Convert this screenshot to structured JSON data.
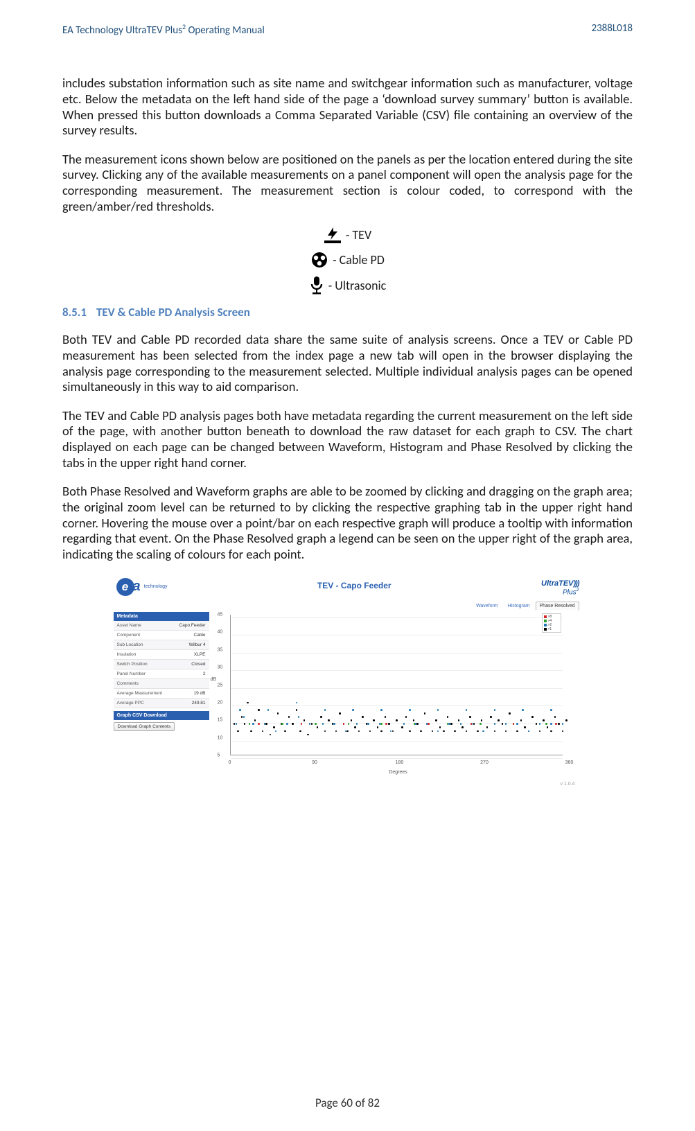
{
  "header": {
    "left_prefix": "EA Technology UltraTEV Plus",
    "left_super": "2",
    "left_suffix": " Operating Manual",
    "right": "2388L018"
  },
  "para1": "includes substation information such as site name and switchgear information such as manufacturer, voltage etc. Below the metadata on the left hand side of the page a ‘download survey summary’ button is available. When pressed this button downloads a Comma Separated Variable (CSV) file containing an overview of the survey results.",
  "para2": "The measurement icons shown below are positioned on the panels as per the location entered during the site survey. Clicking any of the available measurements on a panel component will open the analysis page for the corresponding measurement.   The measurement section is colour coded, to correspond with the green/amber/red thresholds.",
  "icons": {
    "tev": "- TEV",
    "cable": "- Cable PD",
    "ultra": " - Ultrasonic"
  },
  "heading": {
    "num": "8.5.1",
    "title": "TEV & Cable PD Analysis Screen"
  },
  "para3": "Both TEV and Cable PD recorded data share the same suite of analysis screens. Once a TEV or Cable PD measurement has been selected from the index page a new tab will open in the browser displaying the analysis page corresponding to the measurement selected. Multiple individual analysis pages can be opened simultaneously in this way to aid comparison.",
  "para4": "The TEV and Cable PD analysis pages both have metadata regarding the current measurement on the left side of the page, with another button beneath to download the raw dataset for each graph to CSV. The chart displayed on each page can be changed between Waveform, Histogram and Phase Resolved by clicking the tabs in the upper right hand corner.",
  "para5": "Both Phase Resolved and Waveform graphs are able to be zoomed by clicking and dragging on the graph area; the original zoom level can be returned to by clicking the respective graphing tab in the upper right hand corner. Hovering the mouse over a point/bar on each respective graph will produce a tooltip with information regarding that event. On the Phase Resolved graph a legend can be seen on the upper right of the graph area, indicating the scaling of colours for each point.",
  "figure": {
    "title": "TEV - Capo Feeder",
    "logo_right_l1a": "Ultra",
    "logo_right_l1b": "TEV",
    "logo_right_l2": "Plus",
    "logo_right_sup": "2",
    "ea_logo_text": "technology",
    "tabs": {
      "waveform": "Waveform",
      "histogram": "Histogram",
      "phase": "Phase Resolved"
    },
    "meta": {
      "head": "Metadata",
      "rows": [
        {
          "k": "Asset Name",
          "v": "Capo Feeder"
        },
        {
          "k": "Component",
          "v": "Cable"
        },
        {
          "k": "Sub Location",
          "v": "Wilbur 4"
        },
        {
          "k": "Insulation",
          "v": "XLPE"
        },
        {
          "k": "Switch Position",
          "v": "Closed"
        },
        {
          "k": "Panel Number",
          "v": "2"
        },
        {
          "k": "Comments",
          "v": ""
        },
        {
          "k": "Average Measurement",
          "v": "19 dB"
        },
        {
          "k": "Average PPC",
          "v": "249.81"
        }
      ],
      "csv_head": "Graph CSV Download",
      "csv_btn": "Download Graph Contents"
    },
    "axis": {
      "xlabel": "Degrees",
      "ylabel": "dB",
      "xticks": [
        "0",
        "90",
        "180",
        "270",
        "360"
      ],
      "yticks": [
        "5",
        "10",
        "15",
        "20",
        "25",
        "30",
        "35",
        "40",
        "45"
      ]
    },
    "legend": [
      {
        "label": ">8",
        "color": "#d62728"
      },
      {
        "label": ">4",
        "color": "#2ca02c"
      },
      {
        "label": ">2",
        "color": "#1f77b4"
      },
      {
        "label": ">1",
        "color": "#000000"
      }
    ],
    "version": "v 1.0.4"
  },
  "chart_data": {
    "type": "scatter",
    "title": "TEV - Capo Feeder",
    "xlabel": "Degrees",
    "ylabel": "dB",
    "xlim": [
      0,
      360
    ],
    "ylim": [
      5,
      45
    ],
    "xticks": [
      0,
      90,
      180,
      270,
      360
    ],
    "yticks": [
      5,
      10,
      15,
      20,
      25,
      30,
      35,
      40,
      45
    ],
    "legend_position": "upper-right",
    "legend": [
      {
        "name": ">8",
        "color": "#d62728"
      },
      {
        "name": ">4",
        "color": "#2ca02c"
      },
      {
        "name": ">2",
        "color": "#1f77b4"
      },
      {
        "name": ">1",
        "color": "#000000"
      }
    ],
    "series": [
      {
        "name": ">1",
        "color": "#000000",
        "points": [
          [
            4,
            14
          ],
          [
            8,
            12
          ],
          [
            12,
            16
          ],
          [
            15,
            14
          ],
          [
            18,
            20
          ],
          [
            22,
            12
          ],
          [
            26,
            15
          ],
          [
            30,
            18
          ],
          [
            34,
            12
          ],
          [
            38,
            14
          ],
          [
            42,
            11
          ],
          [
            46,
            13
          ],
          [
            50,
            17
          ],
          [
            54,
            14
          ],
          [
            58,
            12
          ],
          [
            62,
            16
          ],
          [
            66,
            14
          ],
          [
            70,
            18
          ],
          [
            74,
            12
          ],
          [
            78,
            15
          ],
          [
            82,
            11
          ],
          [
            86,
            14
          ],
          [
            92,
            13
          ],
          [
            96,
            16
          ],
          [
            100,
            12
          ],
          [
            104,
            15
          ],
          [
            108,
            14
          ],
          [
            112,
            12
          ],
          [
            116,
            17
          ],
          [
            120,
            14
          ],
          [
            124,
            12
          ],
          [
            128,
            15
          ],
          [
            132,
            13
          ],
          [
            136,
            12
          ],
          [
            140,
            16
          ],
          [
            144,
            14
          ],
          [
            148,
            12
          ],
          [
            152,
            15
          ],
          [
            156,
            13
          ],
          [
            160,
            12
          ],
          [
            164,
            16
          ],
          [
            168,
            14
          ],
          [
            172,
            12
          ],
          [
            176,
            15
          ],
          [
            182,
            13
          ],
          [
            186,
            16
          ],
          [
            190,
            12
          ],
          [
            194,
            15
          ],
          [
            198,
            14
          ],
          [
            202,
            12
          ],
          [
            206,
            17
          ],
          [
            210,
            14
          ],
          [
            214,
            12
          ],
          [
            218,
            15
          ],
          [
            222,
            13
          ],
          [
            226,
            12
          ],
          [
            230,
            16
          ],
          [
            234,
            14
          ],
          [
            238,
            12
          ],
          [
            242,
            15
          ],
          [
            246,
            13
          ],
          [
            250,
            12
          ],
          [
            254,
            16
          ],
          [
            258,
            14
          ],
          [
            262,
            12
          ],
          [
            266,
            15
          ],
          [
            272,
            13
          ],
          [
            276,
            16
          ],
          [
            280,
            12
          ],
          [
            284,
            15
          ],
          [
            288,
            14
          ],
          [
            292,
            12
          ],
          [
            296,
            17
          ],
          [
            300,
            14
          ],
          [
            304,
            12
          ],
          [
            308,
            15
          ],
          [
            312,
            13
          ],
          [
            316,
            12
          ],
          [
            320,
            16
          ],
          [
            324,
            14
          ],
          [
            328,
            12
          ],
          [
            332,
            15
          ],
          [
            336,
            13
          ],
          [
            340,
            12
          ],
          [
            344,
            16
          ],
          [
            348,
            14
          ],
          [
            352,
            12
          ],
          [
            356,
            15
          ]
        ]
      },
      {
        "name": ">2",
        "color": "#1f77b4",
        "points": [
          [
            6,
            14
          ],
          [
            14,
            16
          ],
          [
            24,
            14
          ],
          [
            36,
            14
          ],
          [
            48,
            12
          ],
          [
            60,
            14
          ],
          [
            72,
            16
          ],
          [
            84,
            14
          ],
          [
            98,
            14
          ],
          [
            110,
            14
          ],
          [
            122,
            12
          ],
          [
            134,
            14
          ],
          [
            146,
            14
          ],
          [
            158,
            14
          ],
          [
            170,
            12
          ],
          [
            184,
            14
          ],
          [
            196,
            14
          ],
          [
            208,
            14
          ],
          [
            220,
            12
          ],
          [
            232,
            14
          ],
          [
            244,
            14
          ],
          [
            256,
            14
          ],
          [
            268,
            12
          ],
          [
            280,
            14
          ],
          [
            292,
            14
          ],
          [
            304,
            14
          ],
          [
            316,
            12
          ],
          [
            328,
            14
          ],
          [
            340,
            14
          ],
          [
            352,
            14
          ],
          [
            10,
            18
          ],
          [
            40,
            18
          ],
          [
            70,
            20
          ],
          [
            100,
            18
          ],
          [
            130,
            18
          ],
          [
            160,
            18
          ],
          [
            190,
            18
          ],
          [
            220,
            18
          ],
          [
            250,
            18
          ],
          [
            280,
            18
          ],
          [
            310,
            18
          ],
          [
            340,
            18
          ]
        ]
      },
      {
        "name": ">4",
        "color": "#2ca02c",
        "points": [
          [
            20,
            14
          ],
          [
            55,
            14
          ],
          [
            90,
            14
          ],
          [
            125,
            14
          ],
          [
            160,
            14
          ],
          [
            195,
            14
          ],
          [
            230,
            14
          ],
          [
            265,
            14
          ],
          [
            300,
            14
          ],
          [
            335,
            14
          ]
        ]
      },
      {
        "name": ">8",
        "color": "#d62728",
        "points": [
          [
            30,
            14
          ],
          [
            75,
            14
          ],
          [
            120,
            14
          ],
          [
            165,
            14
          ],
          [
            210,
            14
          ],
          [
            255,
            14
          ],
          [
            300,
            14
          ],
          [
            345,
            14
          ]
        ]
      }
    ]
  },
  "footer": {
    "prefix": "Page ",
    "current": "60",
    "of": " of ",
    "total": "82"
  }
}
